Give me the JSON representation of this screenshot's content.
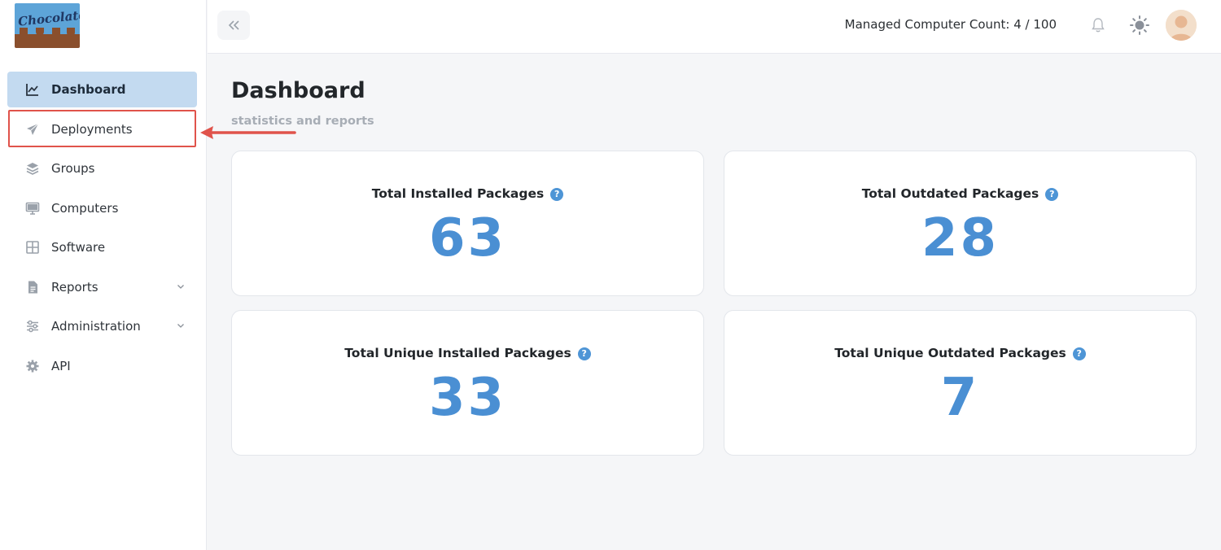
{
  "logo": {
    "text": "Chocolatey"
  },
  "sidebar": {
    "items": [
      {
        "label": "Dashboard",
        "icon": "chart-line-icon",
        "active": true
      },
      {
        "label": "Deployments",
        "icon": "paper-plane-icon",
        "active": false
      },
      {
        "label": "Groups",
        "icon": "layers-icon",
        "active": false
      },
      {
        "label": "Computers",
        "icon": "monitor-icon",
        "active": false
      },
      {
        "label": "Software",
        "icon": "grid-icon",
        "active": false
      },
      {
        "label": "Reports",
        "icon": "file-report-icon",
        "active": false,
        "expandable": true
      },
      {
        "label": "Administration",
        "icon": "sliders-icon",
        "active": false,
        "expandable": true
      },
      {
        "label": "API",
        "icon": "gear-icon",
        "active": false
      }
    ]
  },
  "header": {
    "managed_count": "Managed Computer Count: 4 / 100",
    "icons": [
      "collapse-icon",
      "bell-icon",
      "sun-icon",
      "avatar"
    ]
  },
  "page": {
    "title": "Dashboard",
    "subtitle": "statistics and reports"
  },
  "cards": [
    {
      "title": "Total Installed Packages",
      "value": "63"
    },
    {
      "title": "Total Outdated Packages",
      "value": "28"
    },
    {
      "title": "Total Unique Installed Packages",
      "value": "33"
    },
    {
      "title": "Total Unique Outdated Packages",
      "value": "7"
    }
  ],
  "help_glyph": "?",
  "colors": {
    "accent": "#4a8fd3",
    "active_nav": "#c3daf0",
    "annotation": "#e0534b"
  }
}
